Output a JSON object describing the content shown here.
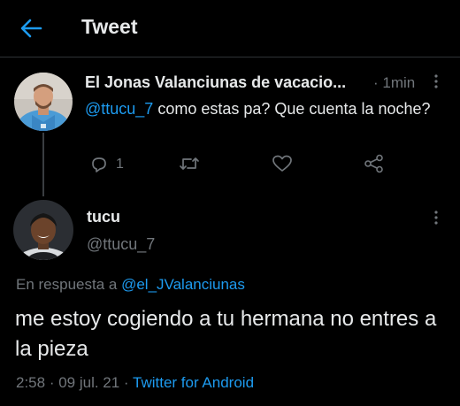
{
  "header": {
    "title": "Tweet",
    "back_icon": "arrow-left-icon"
  },
  "colors": {
    "accent": "#1d9bf0",
    "muted": "#71767b",
    "text": "#e7e9ea",
    "background": "#000000"
  },
  "parent_tweet": {
    "display_name": "El Jonas Valanciunas de vacacio...",
    "separator": "·",
    "time": "1min",
    "mention": "@ttucu_7",
    "text": " como estas pa? Que cuenta la noche?",
    "reply_count": "1",
    "icons": [
      "reply-icon",
      "retweet-icon",
      "like-icon",
      "share-icon"
    ]
  },
  "main_tweet": {
    "display_name": "tucu",
    "handle": "@ttucu_7",
    "in_reply_prefix": "En respuesta a ",
    "in_reply_handle": "@el_JValanciunas",
    "text": "me estoy cogiendo a tu hermana no entres a la pieza",
    "time": "2:58",
    "date": "09 jul. 21",
    "meta_separator": " · ",
    "source": "Twitter for Android"
  }
}
